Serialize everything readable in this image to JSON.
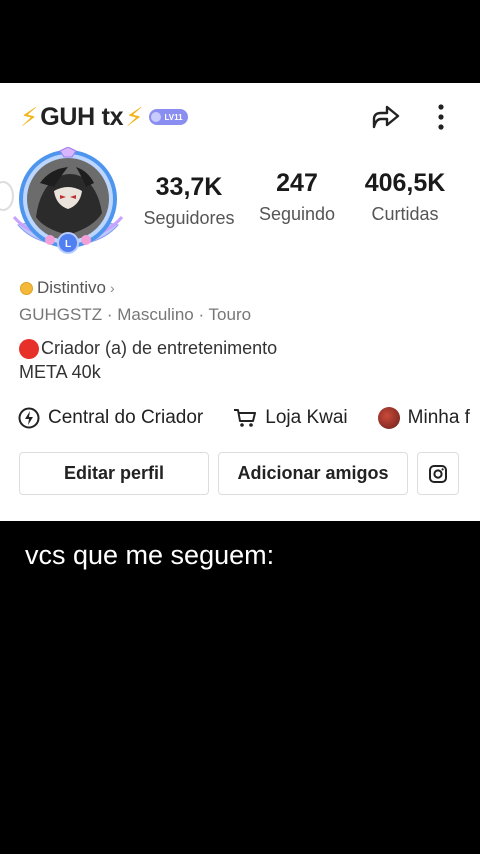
{
  "profile": {
    "username": "GUH tx",
    "level_badge": "LV11",
    "stats": [
      {
        "value": "33,7K",
        "label": "Seguidores"
      },
      {
        "value": "247",
        "label": "Seguindo"
      },
      {
        "value": "406,5K",
        "label": "Curtidas"
      }
    ],
    "distintivo": "Distintivo",
    "tags": "GUHGSTZ · Masculino · Touro",
    "bio_line1": "Criador (a) de entretenimento",
    "bio_line2": "META 40k",
    "links": {
      "creator_center": "Central do Criador",
      "kwai_shop": "Loja Kwai",
      "my_item": "Minha f"
    },
    "buttons": {
      "edit_profile": "Editar perfil",
      "add_friends": "Adicionar amigos"
    }
  },
  "caption": "vcs que me seguem:",
  "colors": {
    "bolt": "#f2b51d",
    "badge": "#8a8ef0",
    "avatar_ring": "#5aa8f0",
    "red_dot": "#e8302a"
  }
}
